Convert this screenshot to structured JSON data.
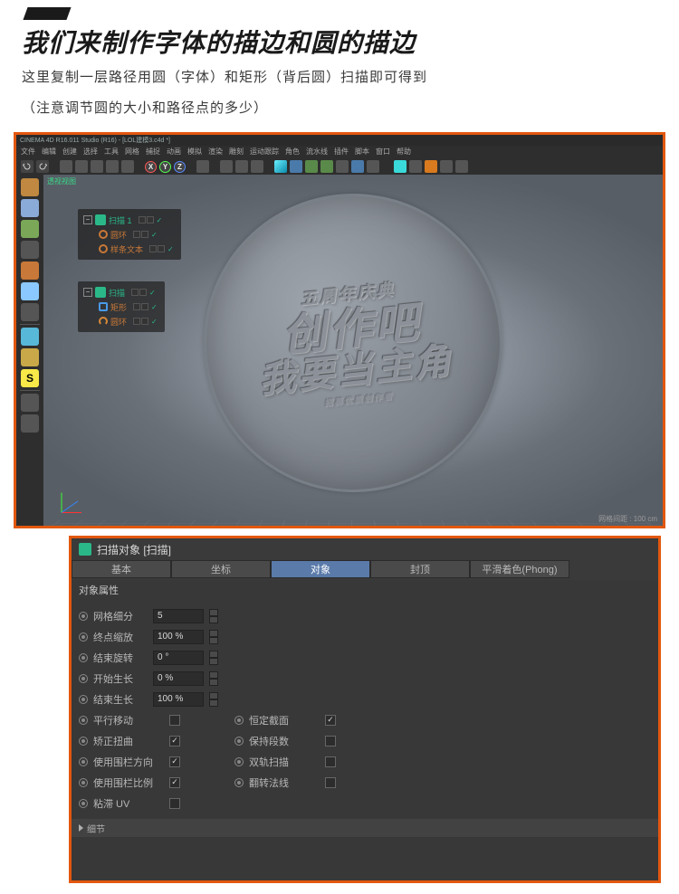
{
  "header": {
    "title": "我们来制作字体的描边和圆的描边",
    "sub_a": "这里复制一层路径用圆（字体）和矩形（背后圆）扫描即可得到",
    "sub_b": "（注意调节圆的大小和路径点的多少）"
  },
  "app": {
    "titlebar": "CINEMA 4D R16.011 Studio (R16) - [LOL建模3.c4d *]",
    "menu": [
      "文件",
      "编辑",
      "创建",
      "选择",
      "工具",
      "网格",
      "捕捉",
      "动画",
      "模拟",
      "渲染",
      "雕刻",
      "运动跟踪",
      "角色",
      "流水线",
      "插件",
      "脚本",
      "窗口",
      "帮助"
    ],
    "axes": [
      "X",
      "Y",
      "Z"
    ],
    "viewport_label": "透视视图",
    "footer_scale": "网格间距 : 100 cm"
  },
  "emblem": {
    "line1": "五周年庆典",
    "line2": "创作吧",
    "line3": "我要当主角",
    "line4": "招募优质创作者"
  },
  "hierarchy": {
    "a": {
      "parent": "扫描 1",
      "child1": "圆环",
      "child2": "样条文本"
    },
    "b": {
      "parent": "扫描",
      "child1": "矩形",
      "child2": "圆环"
    }
  },
  "attr": {
    "title": "扫描对象 [扫描]",
    "tabs": [
      "基本",
      "坐标",
      "对象",
      "封顶",
      "平滑着色(Phong)"
    ],
    "section": "对象属性",
    "rows_num": [
      {
        "label": "网格细分",
        "value": "5"
      },
      {
        "label": "终点缩放",
        "value": "100 %"
      },
      {
        "label": "结束旋转",
        "value": "0 °"
      },
      {
        "label": "开始生长",
        "value": "0 %"
      },
      {
        "label": "结束生长",
        "value": "100 %"
      }
    ],
    "rows_chk_left": [
      {
        "label": "平行移动",
        "checked": false
      },
      {
        "label": "矫正扭曲",
        "checked": true
      },
      {
        "label": "使用围栏方向",
        "checked": true
      },
      {
        "label": "使用围栏比例",
        "checked": true
      },
      {
        "label": "粘滞 UV",
        "checked": false
      }
    ],
    "rows_chk_right": [
      {
        "label": "恒定截面",
        "checked": true
      },
      {
        "label": "保持段数",
        "checked": false
      },
      {
        "label": "双轨扫描",
        "checked": false
      },
      {
        "label": "翻转法线",
        "checked": false
      }
    ],
    "details": "细节"
  }
}
